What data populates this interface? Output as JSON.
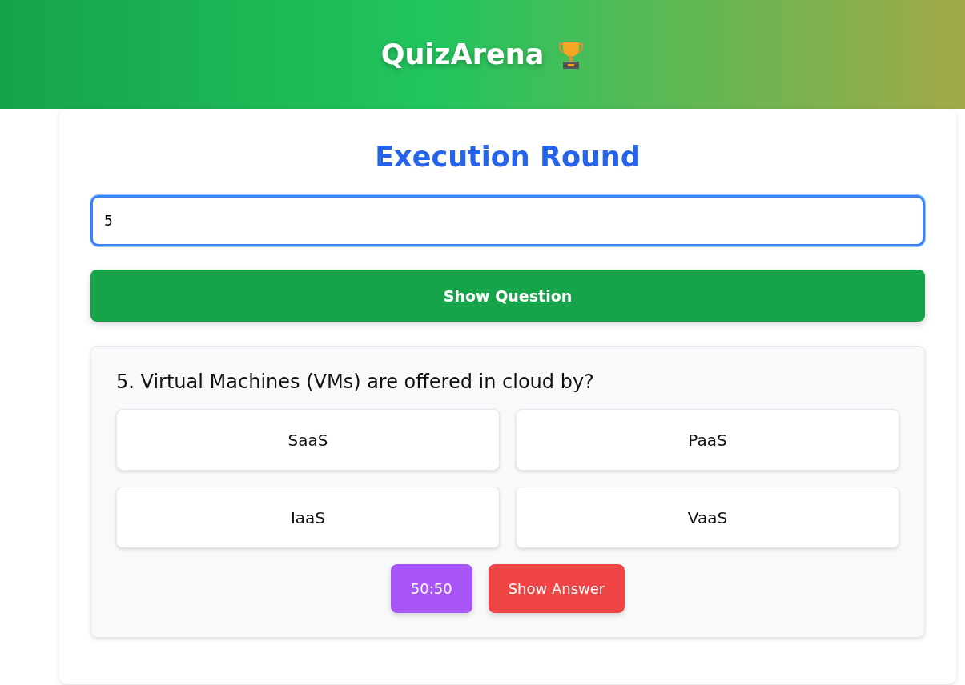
{
  "header": {
    "title": "QuizArena"
  },
  "round_title": "Execution Round",
  "question_number_field": {
    "value": "5"
  },
  "show_question_button": "Show Question",
  "question": {
    "text": "5. Virtual Machines (VMs) are offered in cloud by?",
    "options": [
      {
        "label": "SaaS",
        "selected": false
      },
      {
        "label": "PaaS",
        "selected": false
      },
      {
        "label": "IaaS",
        "selected": false
      },
      {
        "label": "VaaS",
        "selected": false
      }
    ],
    "actions": [
      {
        "label": "50:50",
        "kind": "lifeline"
      },
      {
        "label": "Show Answer",
        "kind": "reveal"
      }
    ]
  }
}
